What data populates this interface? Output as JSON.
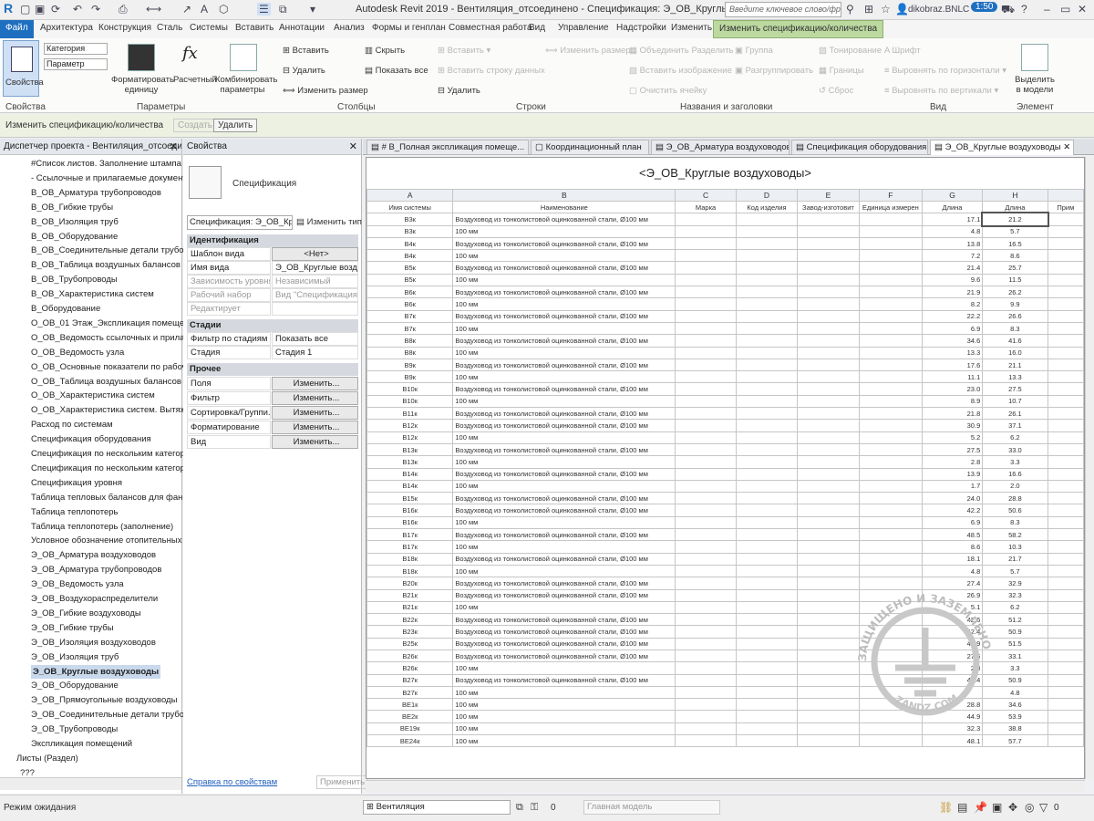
{
  "title_bar": {
    "app_title": "Autodesk Revit 2019 - Вентиляция_отсоединено - Спецификация: Э_ОВ_Круглые воздуховоды",
    "search_placeholder": "Введите ключевое слово/фразу",
    "user": "dikobraz.BNLC",
    "timer": "1:50"
  },
  "ribbon_tabs": [
    "Файл",
    "Архитектура",
    "Конструкция",
    "Сталь",
    "Системы",
    "Вставить",
    "Аннотации",
    "Анализ",
    "Формы и генплан",
    "Совместная работа",
    "Вид",
    "Управление",
    "Надстройки",
    "Изменить",
    "Изменить спецификацию/количества"
  ],
  "ribbon": {
    "properties_btn": "Свойства",
    "category_label": "Категория",
    "parameter_label": "Параметр",
    "format_unit": "Форматировать единицу",
    "calculated": "Расчетный",
    "combine_params": "Комбинировать параметры",
    "col_insert": "Вставить",
    "col_delete": "Удалить",
    "col_resize": "Изменить размер",
    "col_hide": "Скрыть",
    "col_show_all": "Показать все",
    "row_insert": "Вставить",
    "row_insert_data": "Вставить строку данных",
    "row_delete": "Удалить",
    "resize": "Изменить размер",
    "merge": "Объединить Разделить",
    "insert_image": "Вставить изображение",
    "clear_cell": "Очистить ячейку",
    "group": "Группа",
    "ungroup": "Разгруппировать",
    "shading": "Тонирование",
    "borders": "Границы",
    "reset": "Сброс",
    "font": "Шрифт",
    "align_h": "Выровнять по горизонтали",
    "align_v": "Выровнять по вертикали",
    "highlight": "Выделить в модели",
    "groups": [
      "Свойства",
      "Параметры",
      "Столбцы",
      "Строки",
      "Названия и заголовки",
      "Вид",
      "Элемент"
    ]
  },
  "context_bar": {
    "label": "Изменить спецификацию/количества",
    "create": "Создать",
    "delete": "Удалить"
  },
  "browser": {
    "title": "Диспетчер проекта - Вентиляция_отсоедине...",
    "items": [
      "#Список листов. Заполнение штампа",
      "- Ссылочные и прилагаемые документ",
      "В_ОВ_Арматура трубопроводов",
      "В_ОВ_Гибкие трубы",
      "В_ОВ_Изоляция труб",
      "В_ОВ_Оборудование",
      "В_ОВ_Соединительные детали трубопр",
      "В_ОВ_Таблица воздушных балансов",
      "В_ОВ_Трубопроводы",
      "В_ОВ_Характеристика систем",
      "В_Оборудование",
      "О_ОВ_01 Этаж_Экспликация помещени",
      "О_ОВ_Ведомость ссылочных и прилага",
      "О_ОВ_Ведомость узла",
      "О_ОВ_Основные показатели по рабоч",
      "О_ОВ_Таблица воздушных балансов",
      "О_ОВ_Характеристика систем",
      "О_ОВ_Характеристика систем. Вытяжн",
      "Расход по системам",
      "Спецификация оборудования",
      "Спецификация по нескольким категор",
      "Спецификация по нескольким категор",
      "Спецификация уровня",
      "Таблица тепловых балансов для фанко",
      "Таблица теплопотерь",
      "Таблица теплопотерь (заполнение)",
      "Условное обозначение отопительных",
      "Э_ОВ_Арматура воздуховодов",
      "Э_ОВ_Арматура трубопроводов",
      "Э_ОВ_Ведомость узла",
      "Э_ОВ_Воздухораспределители",
      "Э_ОВ_Гибкие воздуховоды",
      "Э_ОВ_Гибкие трубы",
      "Э_ОВ_Изоляция воздуховодов",
      "Э_ОВ_Изоляция труб",
      "Э_ОВ_Круглые воздуховоды",
      "Э_ОВ_Оборудование",
      "Э_ОВ_Прямоугольные воздуховоды",
      "Э_ОВ_Соединительные детали трубопр",
      "Э_ОВ_Трубопроводы",
      "Экспликация помещений",
      "Листы (Раздел)",
      "???"
    ],
    "selected_index": 35
  },
  "properties": {
    "title": "Свойства",
    "type_name": "Спецификация",
    "selector": "Спецификация: Э_ОВ_Кру",
    "edit_type": "Изменить тип",
    "sections": {
      "identification": "Идентификация",
      "stages": "Стадии",
      "other": "Прочее"
    },
    "rows": {
      "view_template": [
        "Шаблон вида",
        "<Нет>"
      ],
      "view_name": [
        "Имя вида",
        "Э_ОВ_Круглые возду..."
      ],
      "level_dep": [
        "Зависимость уровня",
        "Независимый"
      ],
      "workset": [
        "Рабочий набор",
        "Вид \"Спецификация ..."
      ],
      "edited_by": [
        "Редактирует",
        ""
      ],
      "stage_filter": [
        "Фильтр по стадиям",
        "Показать все"
      ],
      "stage": [
        "Стадия",
        "Стадия 1"
      ],
      "fields": [
        "Поля",
        "Изменить..."
      ],
      "filter": [
        "Фильтр",
        "Изменить..."
      ],
      "sorting": [
        "Сортировка/Группи...",
        "Изменить..."
      ],
      "formatting": [
        "Форматирование",
        "Изменить..."
      ],
      "view": [
        "Вид",
        "Изменить..."
      ]
    },
    "help_link": "Справка по свойствам",
    "apply": "Применить"
  },
  "view_tabs": [
    "# В_Полная экспликация помеще...",
    "Координационный план",
    "Э_ОВ_Арматура воздуховодов",
    "Спецификация оборудования",
    "Э_ОВ_Круглые воздуховоды"
  ],
  "schedule": {
    "title": "<Э_ОВ_Круглые воздуховоды>",
    "letters": [
      "A",
      "B",
      "C",
      "D",
      "E",
      "F",
      "G",
      "H",
      ""
    ],
    "headers": [
      "Имя системы",
      "Наименование",
      "Марка",
      "Код изделия",
      "Завод-изготовит",
      "Единица измерен",
      "Длина",
      "Длина",
      "Прим"
    ],
    "desc_long": "Воздуховод из тонколистовой оцинкованной стали, Ø100 мм",
    "desc_short": "100 мм",
    "rows": [
      [
        "В3к",
        "L",
        "17.1",
        "21.2"
      ],
      [
        "В3к",
        "S",
        "4.8",
        "5.7"
      ],
      [
        "В4к",
        "L",
        "13.8",
        "16.5"
      ],
      [
        "В4к",
        "S",
        "7.2",
        "8.6"
      ],
      [
        "В5к",
        "L",
        "21.4",
        "25.7"
      ],
      [
        "В5к",
        "S",
        "9.6",
        "11.5"
      ],
      [
        "В6к",
        "L",
        "21.9",
        "26.2"
      ],
      [
        "В6к",
        "S",
        "8.2",
        "9.9"
      ],
      [
        "В7к",
        "L",
        "22.2",
        "26.6"
      ],
      [
        "В7к",
        "S",
        "6.9",
        "8.3"
      ],
      [
        "В8к",
        "L",
        "34.6",
        "41.6"
      ],
      [
        "В8к",
        "S",
        "13.3",
        "16.0"
      ],
      [
        "В9к",
        "L",
        "17.6",
        "21.1"
      ],
      [
        "В9к",
        "S",
        "11.1",
        "13.3"
      ],
      [
        "В10к",
        "L",
        "23.0",
        "27.5"
      ],
      [
        "В10к",
        "S",
        "8.9",
        "10.7"
      ],
      [
        "В11к",
        "L",
        "21.8",
        "26.1"
      ],
      [
        "В12к",
        "L",
        "30.9",
        "37.1"
      ],
      [
        "В12к",
        "S",
        "5.2",
        "6.2"
      ],
      [
        "В13к",
        "L",
        "27.5",
        "33.0"
      ],
      [
        "В13к",
        "S",
        "2.8",
        "3.3"
      ],
      [
        "В14к",
        "L",
        "13.9",
        "16.6"
      ],
      [
        "В14к",
        "S",
        "1.7",
        "2.0"
      ],
      [
        "В15к",
        "L",
        "24.0",
        "28.8"
      ],
      [
        "В16к",
        "L",
        "42.2",
        "50.6"
      ],
      [
        "В16к",
        "S",
        "6.9",
        "8.3"
      ],
      [
        "В17к",
        "L",
        "48.5",
        "58.2"
      ],
      [
        "В17к",
        "S",
        "8.6",
        "10.3"
      ],
      [
        "В18к",
        "L",
        "18.1",
        "21.7"
      ],
      [
        "В18к",
        "S",
        "4.8",
        "5.7"
      ],
      [
        "В20к",
        "L",
        "27.4",
        "32.9"
      ],
      [
        "В21к",
        "L",
        "26.9",
        "32.3"
      ],
      [
        "В21к",
        "S",
        "5.1",
        "6.2"
      ],
      [
        "В22к",
        "L",
        "42.6",
        "51.2"
      ],
      [
        "В23к",
        "L",
        "42.4",
        "50.9"
      ],
      [
        "В25к",
        "L",
        "42.9",
        "51.5"
      ],
      [
        "В26к",
        "L",
        "27.6",
        "33.1"
      ],
      [
        "В26к",
        "S",
        "2.8",
        "3.3"
      ],
      [
        "В27к",
        "L",
        "42.4",
        "50.9"
      ],
      [
        "В27к",
        "S",
        "",
        "4.8"
      ],
      [
        "ВЕ1к",
        "S",
        "28.8",
        "34.6"
      ],
      [
        "ВЕ2к",
        "S",
        "44.9",
        "53.9"
      ],
      [
        "ВЕ19к",
        "S",
        "32.3",
        "38.8"
      ],
      [
        "ВЕ24к",
        "S",
        "48.1",
        "57.7"
      ]
    ]
  },
  "status_bar": {
    "mode": "Режим ожидания",
    "workset": "Вентиляция",
    "model": "Главная модель",
    "zero": "0"
  },
  "watermark": {
    "text": "ЗАЩИЩЕНО И ЗАЗЕМЛЕНО",
    "site": "ZANDZ.COM"
  }
}
